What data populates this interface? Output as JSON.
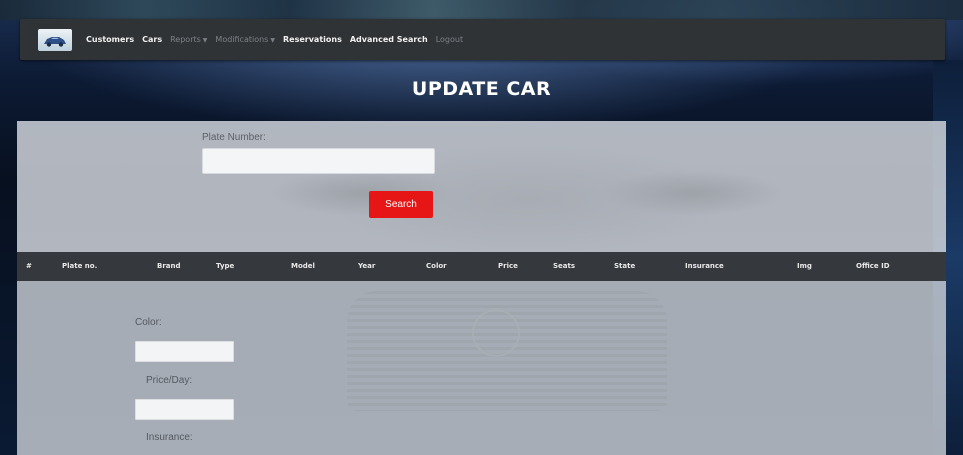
{
  "navbar": {
    "items": [
      {
        "label": "Customers",
        "dim": false
      },
      {
        "label": "Cars",
        "dim": false
      },
      {
        "label": "Reports",
        "dim": true,
        "dropdown": true
      },
      {
        "label": "Modifications",
        "dim": true,
        "dropdown": true
      },
      {
        "label": "Reservations",
        "dim": false
      },
      {
        "label": "Advanced Search",
        "dim": false
      },
      {
        "label": "Logout",
        "dim": true
      }
    ]
  },
  "page": {
    "title": "UPDATE CAR"
  },
  "search": {
    "plate_label": "Plate Number:",
    "plate_value": "",
    "button_label": "Search"
  },
  "table": {
    "columns": [
      "#",
      "Plate no.",
      "Brand",
      "Type",
      "Model",
      "Year",
      "Color",
      "Price",
      "Seats",
      "State",
      "Insurance",
      "Img",
      "Office ID"
    ]
  },
  "form": {
    "color_label": "Color:",
    "color_value": "",
    "price_label": "Price/Day:",
    "price_value": "",
    "insurance_label": "Insurance:"
  },
  "colors": {
    "navbar": "#303336",
    "search_button": "#e61616",
    "table_header": "#35393d"
  }
}
